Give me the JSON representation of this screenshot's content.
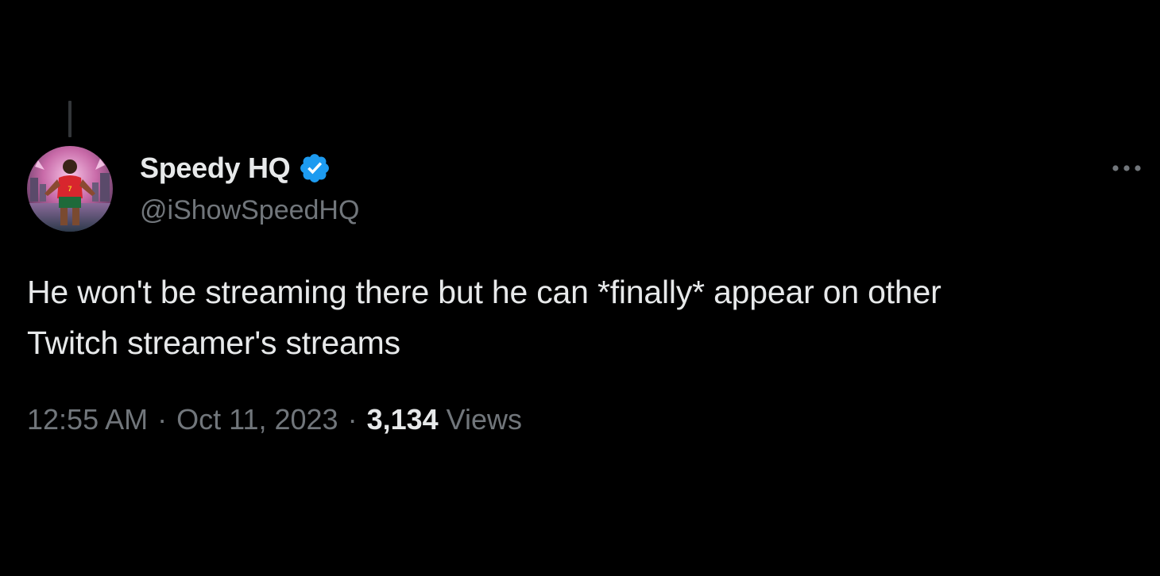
{
  "tweet": {
    "author": {
      "display_name": "Speedy HQ",
      "handle": "@iShowSpeedHQ",
      "verified": true
    },
    "text_line1": "He won't be streaming there but he can *finally* appear on other",
    "text_line2": "Twitch streamer's streams",
    "time": "12:55 AM",
    "date": "Oct 11, 2023",
    "separator": "·",
    "views_count": "3,134",
    "views_label": "Views"
  },
  "icons": {
    "verified": "verified-badge-icon",
    "more": "more-options-icon"
  },
  "colors": {
    "background": "#000000",
    "primary_text": "#e7e9ea",
    "secondary_text": "#71767b",
    "verified_blue": "#1d9bf0"
  }
}
